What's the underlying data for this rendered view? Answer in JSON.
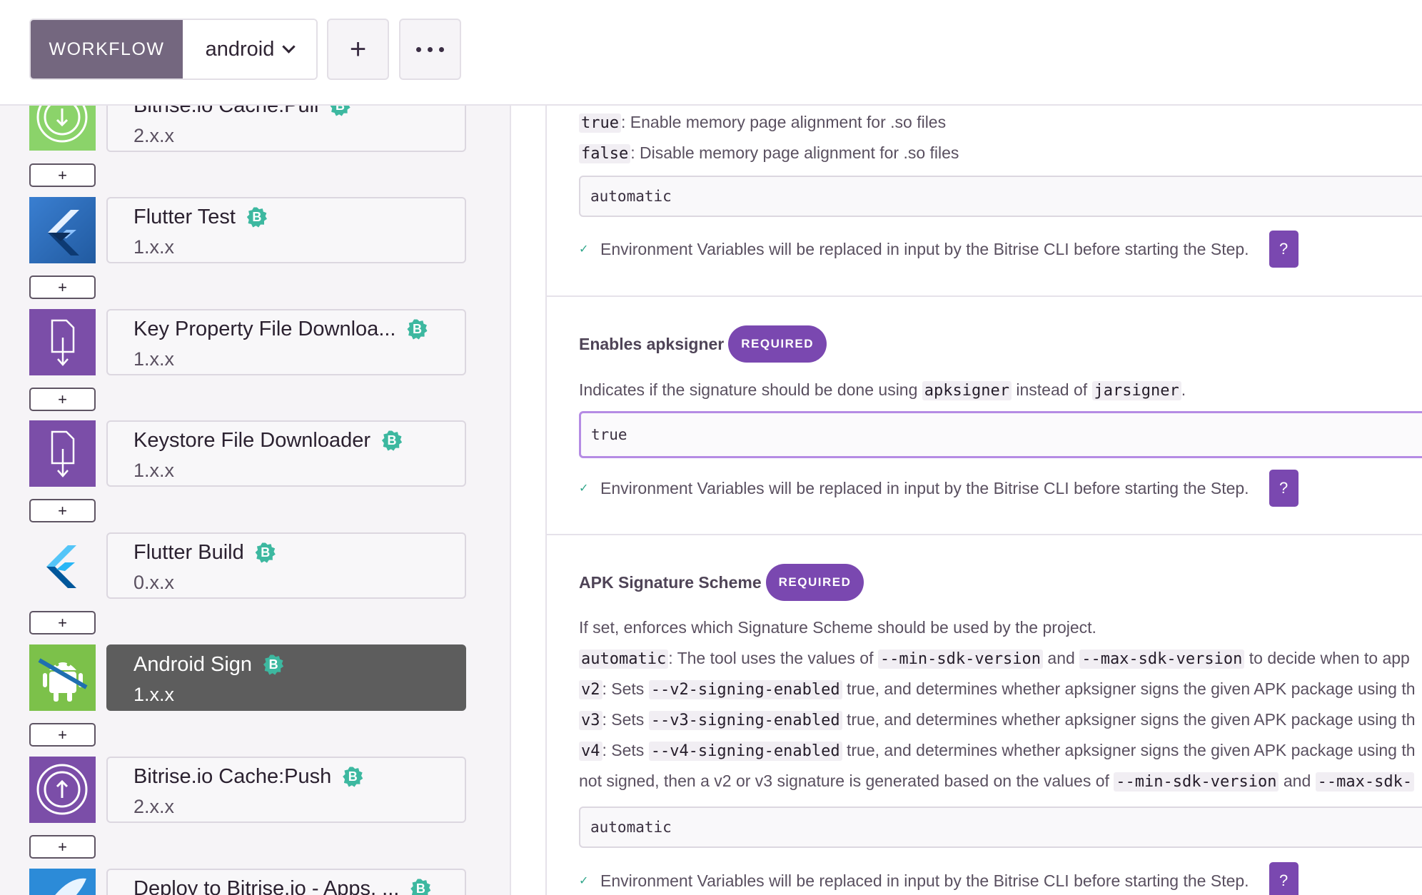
{
  "topbar": {
    "workflow_label": "WORKFLOW",
    "workflow_selected": "android",
    "add_label": "+"
  },
  "steps": [
    {
      "title": "Bitrise.io Cache:Pull",
      "version": "2.x.x",
      "icon": "download-circle-icon",
      "badge": "B"
    },
    {
      "title": "Flutter Test",
      "version": "1.x.x",
      "icon": "flutter-icon",
      "badge": "B"
    },
    {
      "title": "Key Property File Downloa...",
      "version": "1.x.x",
      "icon": "file-download-icon",
      "badge": "B"
    },
    {
      "title": "Keystore File Downloader",
      "version": "1.x.x",
      "icon": "file-download-icon",
      "badge": "B"
    },
    {
      "title": "Flutter Build",
      "version": "0.x.x",
      "icon": "flutter-icon",
      "badge": "B"
    },
    {
      "title": "Android Sign",
      "version": "1.x.x",
      "icon": "android-icon",
      "badge": "B",
      "active": true
    },
    {
      "title": "Bitrise.io Cache:Push",
      "version": "2.x.x",
      "icon": "upload-circle-icon",
      "badge": "B"
    },
    {
      "title": "Deploy to Bitrise.io - Apps, ...",
      "version": "",
      "icon": "deploy-icon",
      "badge": "B"
    }
  ],
  "add_step_label": "+",
  "pagealign": {
    "true_key": "true",
    "true_desc": ": Enable memory page alignment for .so files",
    "false_key": "false",
    "false_desc": ": Disable memory page alignment for .so files",
    "value": "automatic"
  },
  "env_note": "Environment Variables will be replaced in input by the Bitrise CLI before starting the Step.",
  "help_label": "?",
  "apksigner": {
    "title": "Enables apksigner",
    "required": "REQUIRED",
    "desc_1": "Indicates if the signature should be done using ",
    "code_1": "apksigner",
    "desc_2": " instead of ",
    "code_2": "jarsigner",
    "desc_3": ".",
    "value": "true"
  },
  "scheme": {
    "title": "APK Signature Scheme",
    "required": "REQUIRED",
    "desc": "If set, enforces which Signature Scheme should be used by the project.",
    "l1_key": "automatic",
    "l1_a": ": The tool uses the values of ",
    "l1_c1": "--min-sdk-version",
    "l1_b": " and ",
    "l1_c2": "--max-sdk-version",
    "l1_c": " to decide when to app",
    "l2_key": "v2",
    "l2_a": ": Sets ",
    "l2_code": "--v2-signing-enabled",
    "l2_b": " true, and determines whether apksigner signs the given APK package using th",
    "l3_key": "v3",
    "l3_a": ": Sets ",
    "l3_code": "--v3-signing-enabled",
    "l3_b": " true, and determines whether apksigner signs the given APK package using th",
    "l4_key": "v4",
    "l4_a": ": Sets ",
    "l4_code": "--v4-signing-enabled",
    "l4_b": " true, and determines whether apksigner signs the given APK package using th",
    "l5_a": "not signed, then a v2 or v3 signature is generated based on the values of ",
    "l5_c1": "--min-sdk-version",
    "l5_b": " and ",
    "l5_c2": "--max-sdk-",
    "value": "automatic"
  }
}
